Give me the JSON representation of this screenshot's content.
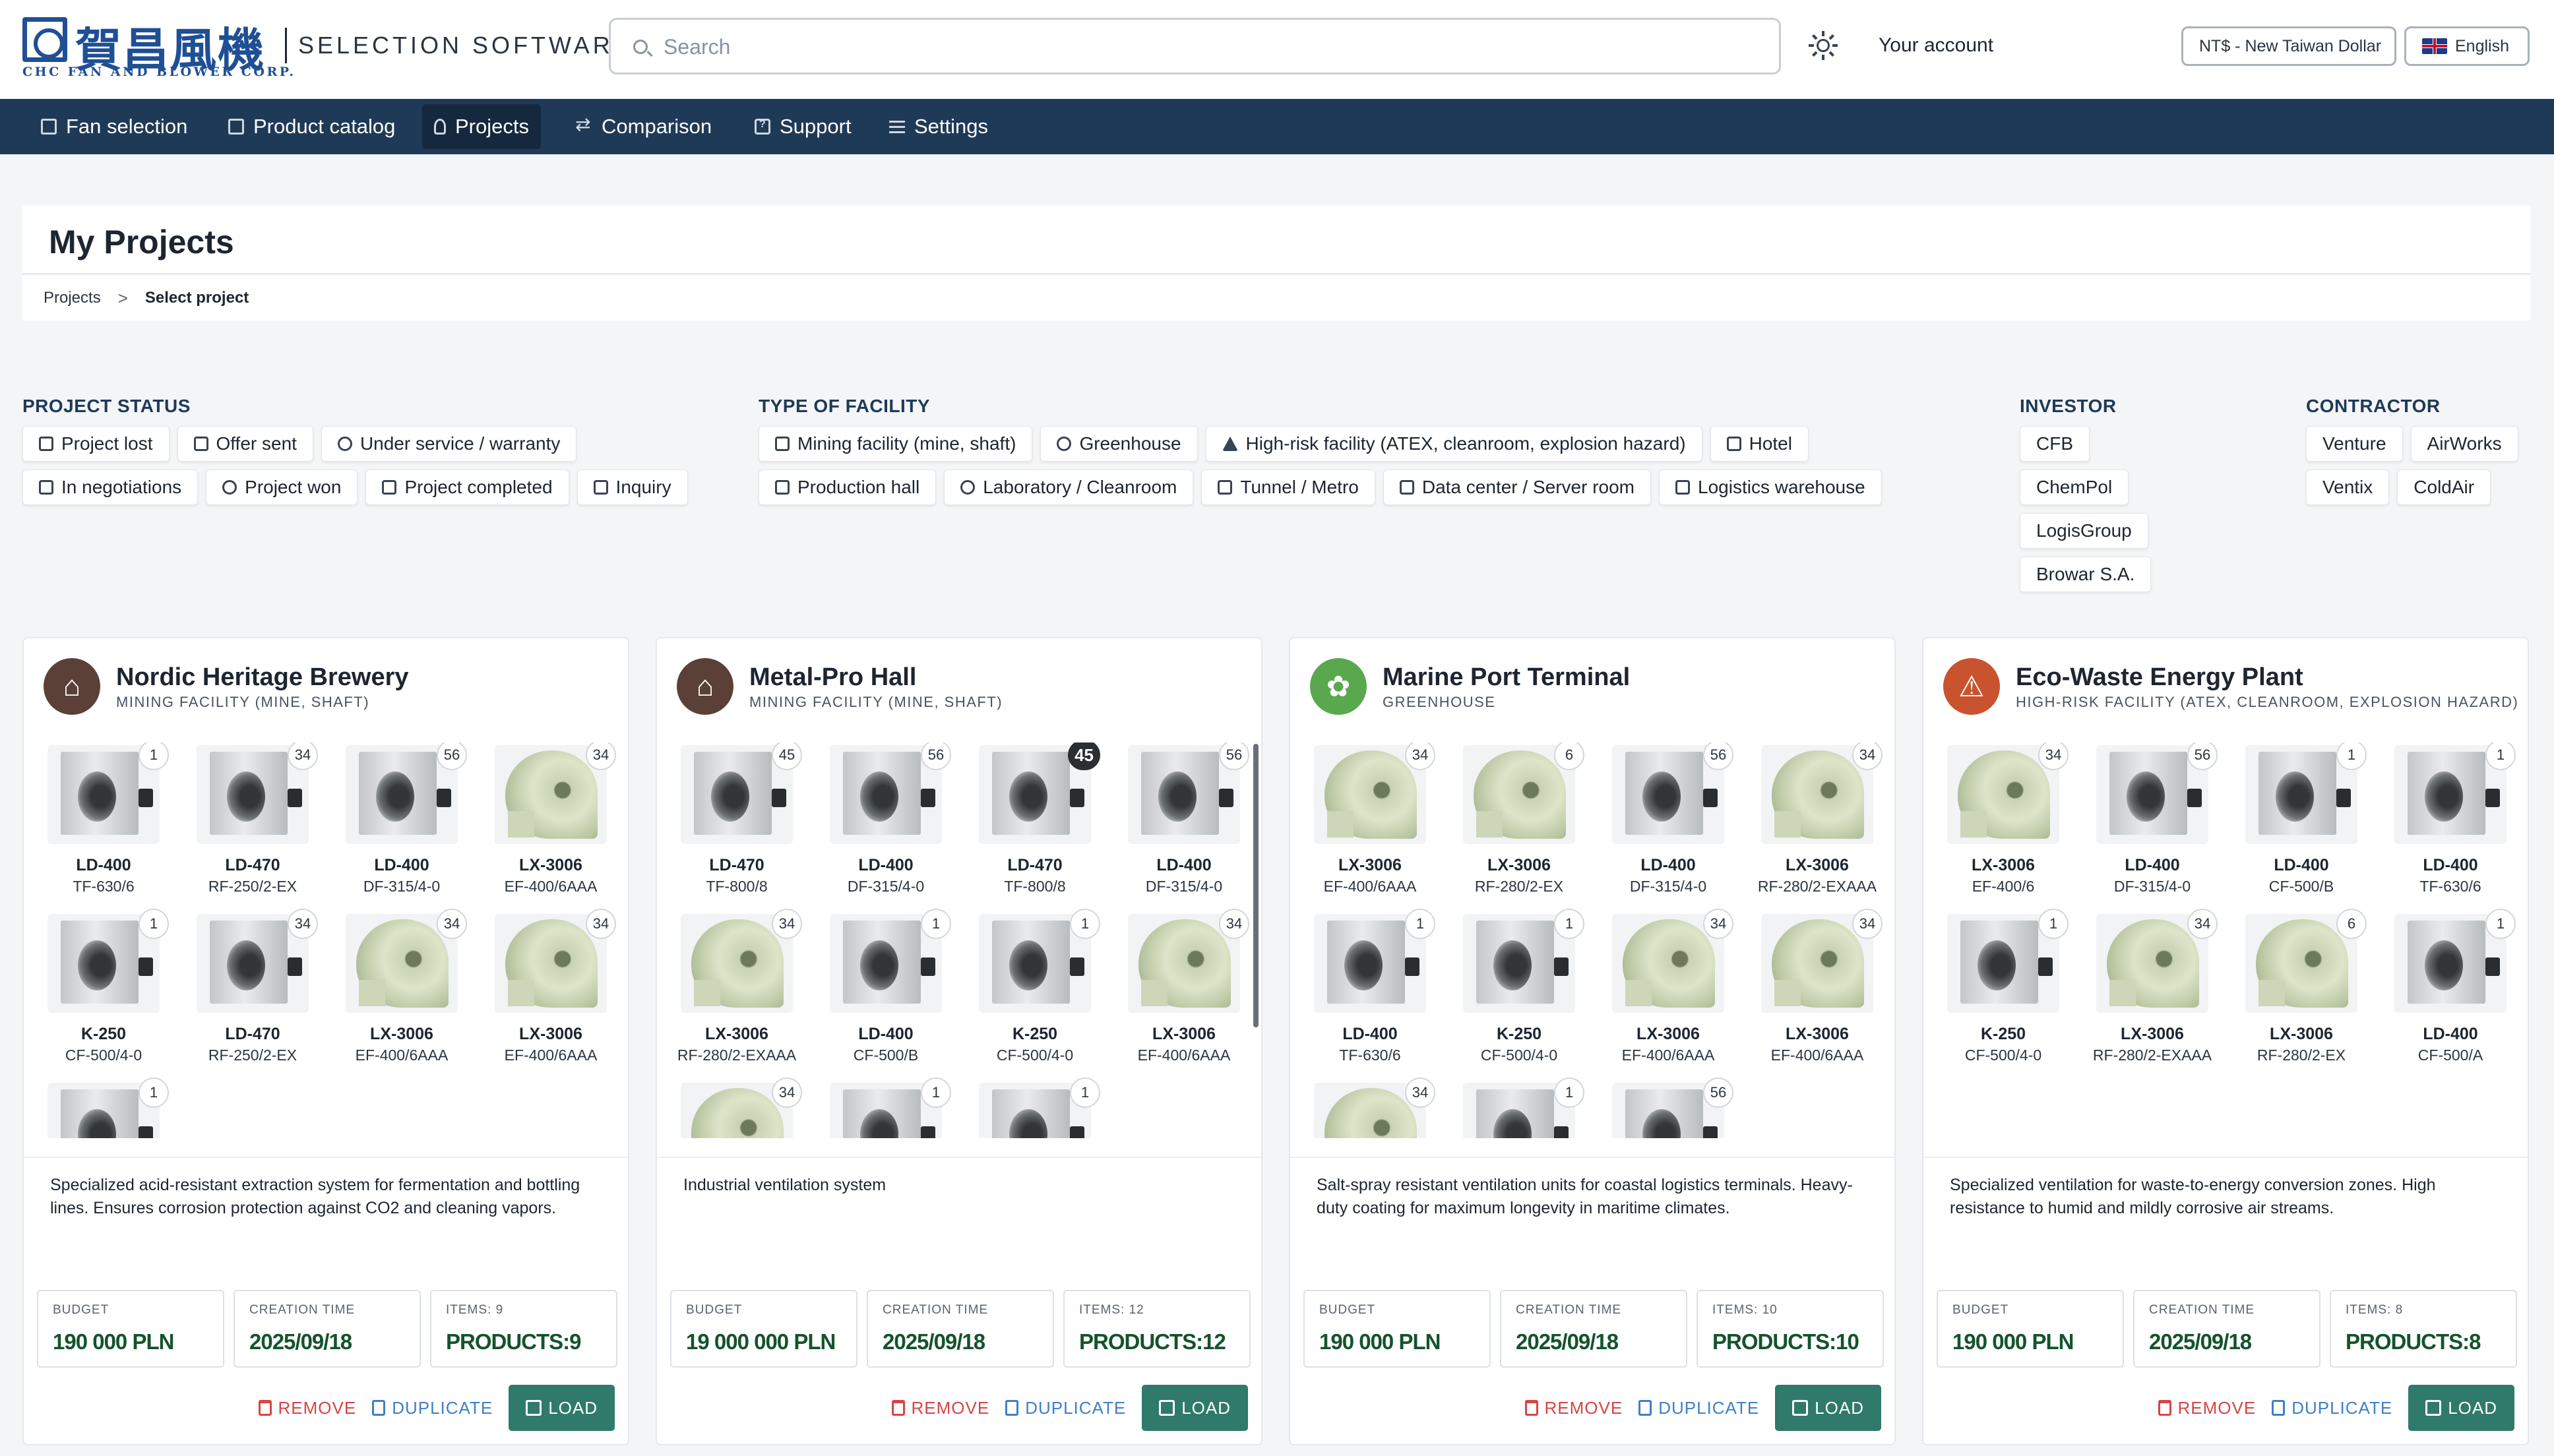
{
  "header": {
    "logo_cjk": "賀昌風機",
    "logo_sub": "CHC FAN AND BLOWER CORP.",
    "app_title": "SELECTION SOFTWARE",
    "search_placeholder": "Search",
    "account": "Your account",
    "currency": "NT$ - New Taiwan Dollar",
    "language": "English"
  },
  "nav": [
    {
      "label": "Fan selection",
      "icon": "grid-icon"
    },
    {
      "label": "Product catalog",
      "icon": "catalog-icon"
    },
    {
      "label": "Projects",
      "icon": "person-icon",
      "active": true
    },
    {
      "label": "Comparison",
      "icon": "compare-icon"
    },
    {
      "label": "Support",
      "icon": "help-icon"
    },
    {
      "label": "Settings",
      "icon": "sliders-icon"
    }
  ],
  "page": {
    "title": "My Projects",
    "breadcrumb": {
      "link": "Projects",
      "sep": ">",
      "current": "Select project"
    }
  },
  "filters": {
    "status": {
      "title": "PROJECT STATUS",
      "items": [
        "Project lost",
        "Offer sent",
        "Under service / warranty",
        "In negotiations",
        "Project won",
        "Project completed",
        "Inquiry"
      ]
    },
    "facility": {
      "title": "TYPE OF FACILITY",
      "items": [
        "Mining facility (mine, shaft)",
        "Greenhouse",
        "High-risk facility (ATEX, cleanroom, explosion hazard)",
        "Hotel",
        "Production hall",
        "Laboratory / Cleanroom",
        "Tunnel / Metro",
        "Data center / Server room",
        "Logistics warehouse"
      ]
    },
    "investor": {
      "title": "INVESTOR",
      "items": [
        "CFB",
        "ChemPol",
        "LogisGroup",
        "Browar S.A."
      ]
    },
    "contractor": {
      "title": "CONTRACTOR",
      "items": [
        "Venture",
        "AirWorks",
        "Ventix",
        "ColdAir"
      ]
    }
  },
  "labels": {
    "budget": "BUDGET",
    "creation_time": "CREATION TIME",
    "remove": "REMOVE",
    "duplicate": "DUPLICATE",
    "load": "LOAD"
  },
  "colors": {
    "nav_bg": "#1e3a57",
    "value_green": "#14532d",
    "load_bg": "#2f7a6a",
    "remove_red": "#d64545",
    "duplicate_blue": "#3f7fc7"
  },
  "projects": [
    {
      "name": "Nordic Heritage Brewery",
      "type": "MINING FACILITY (MINE, SHAFT)",
      "avatar_icon": "mine-icon",
      "avatar_color": "#5a4036",
      "description": "Specialized acid-resistant extraction system for fermentation and bottling lines. Ensures corrosion protection against CO2 and cleaning vapors.",
      "budget": "190 000 PLN",
      "created": "2025/09/18",
      "items_label": "ITEMS: 9",
      "products": "PRODUCTS:9",
      "products_grid": [
        {
          "model": "LD-400",
          "code": "TF-630/6",
          "qty": "1",
          "kind": "box"
        },
        {
          "model": "LD-470",
          "code": "RF-250/2-EX",
          "qty": "34",
          "kind": "box"
        },
        {
          "model": "LD-400",
          "code": "DF-315/4-0",
          "qty": "56",
          "kind": "box"
        },
        {
          "model": "LX-3006",
          "code": "EF-400/6AAA",
          "qty": "34",
          "kind": "green"
        },
        {
          "model": "K-250",
          "code": "CF-500/4-0",
          "qty": "1",
          "kind": "box"
        },
        {
          "model": "LD-470",
          "code": "RF-250/2-EX",
          "qty": "34",
          "kind": "box"
        },
        {
          "model": "LX-3006",
          "code": "EF-400/6AAA",
          "qty": "34",
          "kind": "green"
        },
        {
          "model": "LX-3006",
          "code": "EF-400/6AAA",
          "qty": "34",
          "kind": "green"
        },
        {
          "model": "",
          "code": "",
          "qty": "1",
          "kind": "box"
        }
      ]
    },
    {
      "name": "Metal-Pro Hall",
      "type": "MINING FACILITY (MINE, SHAFT)",
      "avatar_icon": "mine-icon",
      "avatar_color": "#5a4036",
      "description": "Industrial ventilation system",
      "budget": "19 000 000 PLN",
      "created": "2025/09/18",
      "items_label": "ITEMS: 12",
      "products": "PRODUCTS:12",
      "products_grid": [
        {
          "model": "LD-470",
          "code": "TF-800/8",
          "qty": "45",
          "kind": "box"
        },
        {
          "model": "LD-400",
          "code": "DF-315/4-0",
          "qty": "56",
          "kind": "box"
        },
        {
          "model": "LD-470",
          "code": "TF-800/8",
          "qty": "45",
          "kind": "box",
          "highlight": true
        },
        {
          "model": "LD-400",
          "code": "DF-315/4-0",
          "qty": "56",
          "kind": "box"
        },
        {
          "model": "LX-3006",
          "code": "RF-280/2-EXAAA",
          "qty": "34",
          "kind": "green"
        },
        {
          "model": "LD-400",
          "code": "CF-500/B",
          "qty": "1",
          "kind": "box"
        },
        {
          "model": "K-250",
          "code": "CF-500/4-0",
          "qty": "1",
          "kind": "box"
        },
        {
          "model": "LX-3006",
          "code": "EF-400/6AAA",
          "qty": "34",
          "kind": "green"
        },
        {
          "model": "",
          "code": "",
          "qty": "34",
          "kind": "green"
        },
        {
          "model": "",
          "code": "",
          "qty": "1",
          "kind": "box"
        },
        {
          "model": "",
          "code": "",
          "qty": "1",
          "kind": "box"
        }
      ]
    },
    {
      "name": "Marine Port Terminal",
      "type": "GREENHOUSE",
      "avatar_icon": "plant-icon",
      "avatar_color": "#5aa84e",
      "description": "Salt-spray resistant ventilation units for coastal logistics terminals. Heavy-duty coating for maximum longevity in maritime climates.",
      "budget": "190 000 PLN",
      "created": "2025/09/18",
      "items_label": "ITEMS: 10",
      "products": "PRODUCTS:10",
      "products_grid": [
        {
          "model": "LX-3006",
          "code": "EF-400/6AAA",
          "qty": "34",
          "kind": "green"
        },
        {
          "model": "LX-3006",
          "code": "RF-280/2-EX",
          "qty": "6",
          "kind": "green"
        },
        {
          "model": "LD-400",
          "code": "DF-315/4-0",
          "qty": "56",
          "kind": "box"
        },
        {
          "model": "LX-3006",
          "code": "RF-280/2-EXAAA",
          "qty": "34",
          "kind": "green"
        },
        {
          "model": "LD-400",
          "code": "TF-630/6",
          "qty": "1",
          "kind": "box"
        },
        {
          "model": "K-250",
          "code": "CF-500/4-0",
          "qty": "1",
          "kind": "box"
        },
        {
          "model": "LX-3006",
          "code": "EF-400/6AAA",
          "qty": "34",
          "kind": "green"
        },
        {
          "model": "LX-3006",
          "code": "EF-400/6AAA",
          "qty": "34",
          "kind": "green"
        },
        {
          "model": "",
          "code": "",
          "qty": "34",
          "kind": "green"
        },
        {
          "model": "",
          "code": "",
          "qty": "1",
          "kind": "box"
        },
        {
          "model": "",
          "code": "",
          "qty": "56",
          "kind": "box"
        }
      ]
    },
    {
      "name": "Eco-Waste Energy Plant",
      "type": "HIGH-RISK FACILITY (ATEX, CLEANROOM, EXPLOSION HAZARD)",
      "avatar_icon": "warning-icon",
      "avatar_color": "#c9532e",
      "description": "Specialized ventilation for waste-to-energy conversion zones. High resistance to humid and mildly corrosive air streams.",
      "budget": "190 000 PLN",
      "created": "2025/09/18",
      "items_label": "ITEMS: 8",
      "products": "PRODUCTS:8",
      "products_grid": [
        {
          "model": "LX-3006",
          "code": "EF-400/6",
          "qty": "34",
          "kind": "green"
        },
        {
          "model": "LD-400",
          "code": "DF-315/4-0",
          "qty": "56",
          "kind": "box"
        },
        {
          "model": "LD-400",
          "code": "CF-500/B",
          "qty": "1",
          "kind": "box"
        },
        {
          "model": "LD-400",
          "code": "TF-630/6",
          "qty": "1",
          "kind": "box"
        },
        {
          "model": "K-250",
          "code": "CF-500/4-0",
          "qty": "1",
          "kind": "box"
        },
        {
          "model": "LX-3006",
          "code": "RF-280/2-EXAAA",
          "qty": "34",
          "kind": "green"
        },
        {
          "model": "LX-3006",
          "code": "RF-280/2-EX",
          "qty": "6",
          "kind": "green"
        },
        {
          "model": "LD-400",
          "code": "CF-500/A",
          "qty": "1",
          "kind": "box"
        }
      ]
    }
  ]
}
